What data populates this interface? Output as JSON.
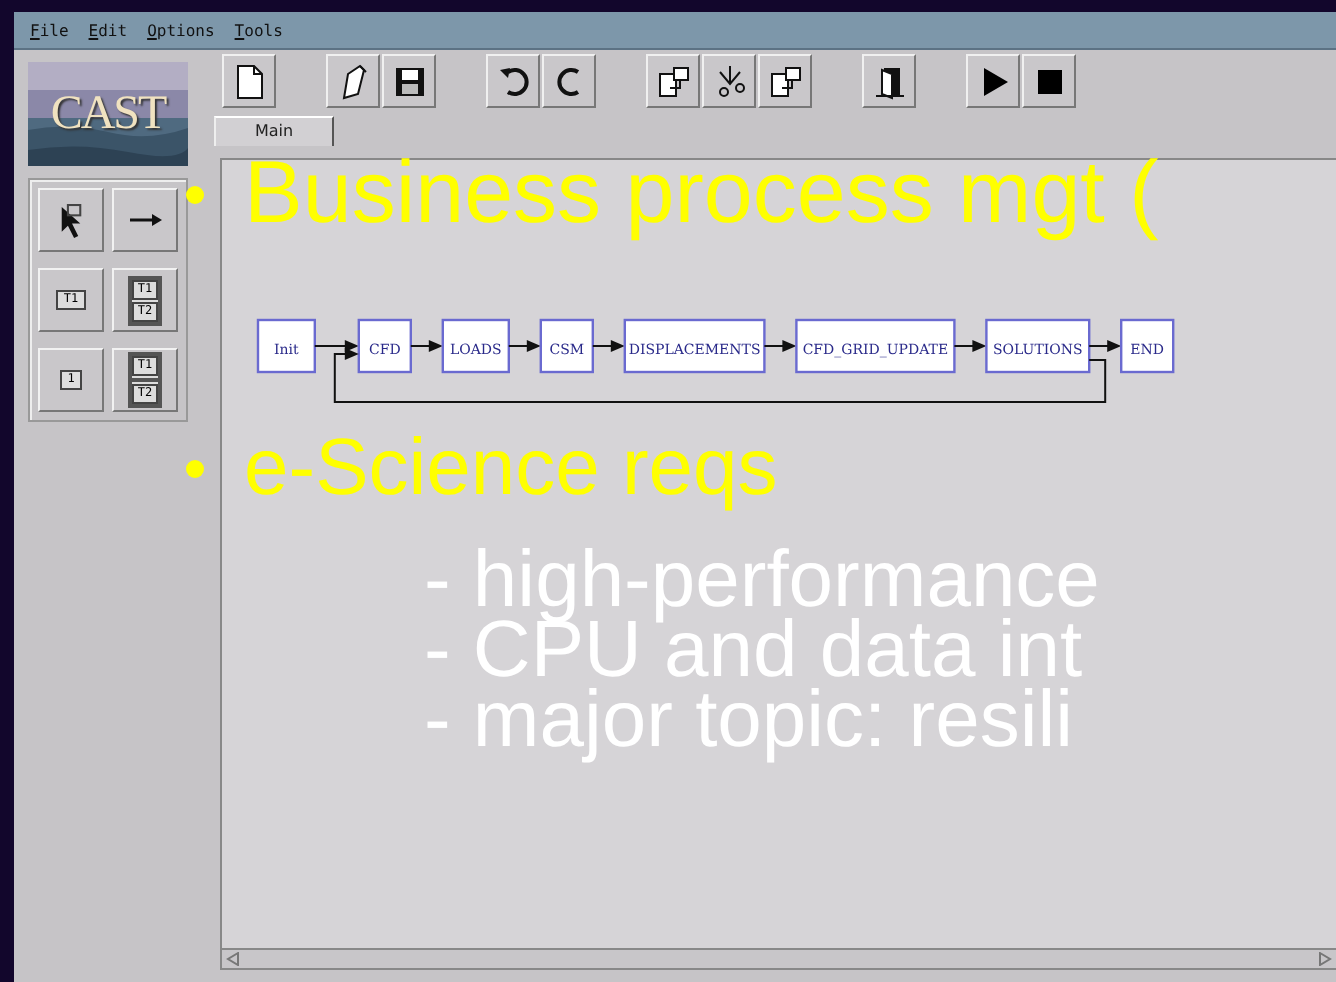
{
  "menu": [
    {
      "label": "File"
    },
    {
      "label": "Edit"
    },
    {
      "label": "Options"
    },
    {
      "label": "Tools"
    }
  ],
  "logo": {
    "text": "CAST"
  },
  "toolbar": [
    {
      "kind": "new"
    },
    {
      "kind": "gap"
    },
    {
      "kind": "edit"
    },
    {
      "kind": "save"
    },
    {
      "kind": "gap"
    },
    {
      "kind": "undo"
    },
    {
      "kind": "redo"
    },
    {
      "kind": "gap"
    },
    {
      "kind": "copy"
    },
    {
      "kind": "cut"
    },
    {
      "kind": "paste"
    },
    {
      "kind": "gap"
    },
    {
      "kind": "exit"
    },
    {
      "kind": "gap"
    },
    {
      "kind": "play"
    },
    {
      "kind": "stop"
    }
  ],
  "tabs": [
    {
      "label": "Main",
      "selected": true
    }
  ],
  "palette": [
    {
      "kind": "select"
    },
    {
      "kind": "connect"
    },
    {
      "kind": "single",
      "labels": [
        "T1"
      ]
    },
    {
      "kind": "stack",
      "labels": [
        "T1",
        "T2"
      ]
    },
    {
      "kind": "single",
      "labels": [
        "1"
      ]
    },
    {
      "kind": "parallel",
      "labels": [
        "T1",
        "T2"
      ]
    }
  ],
  "workflow": {
    "nodes": [
      {
        "label": "Init"
      },
      {
        "label": "CFD",
        "loop_target": true
      },
      {
        "label": "LOADS"
      },
      {
        "label": "CSM"
      },
      {
        "label": "DISPLACEMENTS"
      },
      {
        "label": "CFD_GRID_UPDATE"
      },
      {
        "label": "SOLUTIONS",
        "loop_source": true
      },
      {
        "label": "END"
      }
    ]
  },
  "slide": [
    {
      "kind": "bullet",
      "text": "Business process mgt ("
    },
    {
      "kind": "bullet",
      "text": "e-Science reqs"
    },
    {
      "kind": "sub",
      "text": "- high-performance"
    },
    {
      "kind": "sub",
      "text": "- CPU and data int"
    },
    {
      "kind": "sub",
      "text": "- major topic: resili"
    }
  ]
}
